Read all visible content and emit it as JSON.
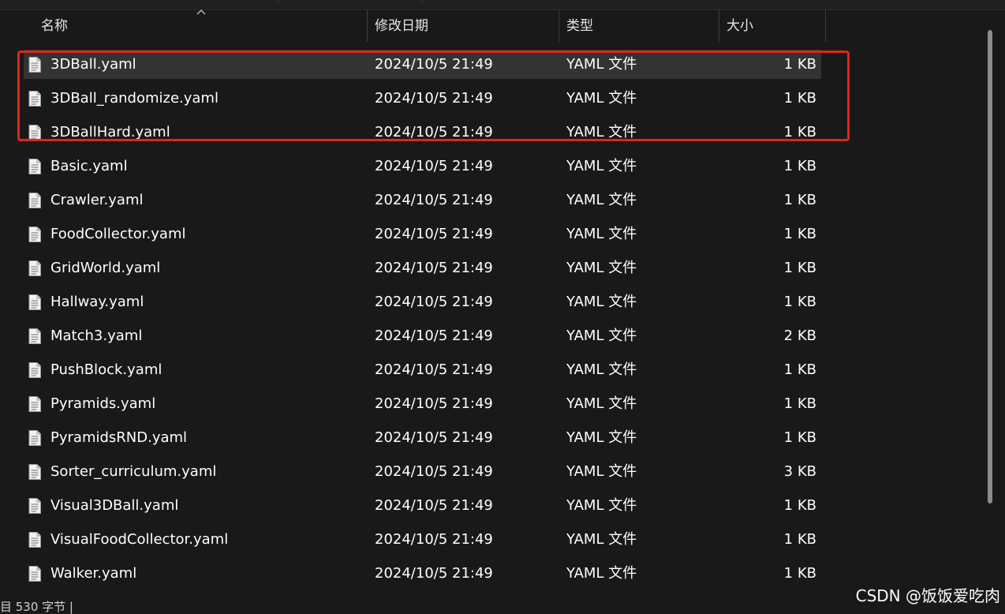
{
  "header": {
    "name": "名称",
    "date": "修改日期",
    "type": "类型",
    "size": "大小"
  },
  "files": [
    {
      "name": "3DBall.yaml",
      "date": "2024/10/5 21:49",
      "type": "YAML 文件",
      "size": "1 KB",
      "selected": true
    },
    {
      "name": "3DBall_randomize.yaml",
      "date": "2024/10/5 21:49",
      "type": "YAML 文件",
      "size": "1 KB"
    },
    {
      "name": "3DBallHard.yaml",
      "date": "2024/10/5 21:49",
      "type": "YAML 文件",
      "size": "1 KB"
    },
    {
      "name": "Basic.yaml",
      "date": "2024/10/5 21:49",
      "type": "YAML 文件",
      "size": "1 KB"
    },
    {
      "name": "Crawler.yaml",
      "date": "2024/10/5 21:49",
      "type": "YAML 文件",
      "size": "1 KB"
    },
    {
      "name": "FoodCollector.yaml",
      "date": "2024/10/5 21:49",
      "type": "YAML 文件",
      "size": "1 KB"
    },
    {
      "name": "GridWorld.yaml",
      "date": "2024/10/5 21:49",
      "type": "YAML 文件",
      "size": "1 KB"
    },
    {
      "name": "Hallway.yaml",
      "date": "2024/10/5 21:49",
      "type": "YAML 文件",
      "size": "1 KB"
    },
    {
      "name": "Match3.yaml",
      "date": "2024/10/5 21:49",
      "type": "YAML 文件",
      "size": "2 KB"
    },
    {
      "name": "PushBlock.yaml",
      "date": "2024/10/5 21:49",
      "type": "YAML 文件",
      "size": "1 KB"
    },
    {
      "name": "Pyramids.yaml",
      "date": "2024/10/5 21:49",
      "type": "YAML 文件",
      "size": "1 KB"
    },
    {
      "name": "PyramidsRND.yaml",
      "date": "2024/10/5 21:49",
      "type": "YAML 文件",
      "size": "1 KB"
    },
    {
      "name": "Sorter_curriculum.yaml",
      "date": "2024/10/5 21:49",
      "type": "YAML 文件",
      "size": "3 KB"
    },
    {
      "name": "Visual3DBall.yaml",
      "date": "2024/10/5 21:49",
      "type": "YAML 文件",
      "size": "1 KB"
    },
    {
      "name": "VisualFoodCollector.yaml",
      "date": "2024/10/5 21:49",
      "type": "YAML 文件",
      "size": "1 KB"
    },
    {
      "name": "Walker.yaml",
      "date": "2024/10/5 21:49",
      "type": "YAML 文件",
      "size": "1 KB"
    }
  ],
  "status": {
    "text": "目 530 字节 |"
  },
  "watermark": "CSDN @饭饭爱吃肉",
  "colors": {
    "background": "#191919",
    "selected_row": "#333333",
    "highlight_box": "#e1251b"
  },
  "icons": {
    "file": "text-document-icon",
    "sort": "sort-ascending-icon"
  }
}
